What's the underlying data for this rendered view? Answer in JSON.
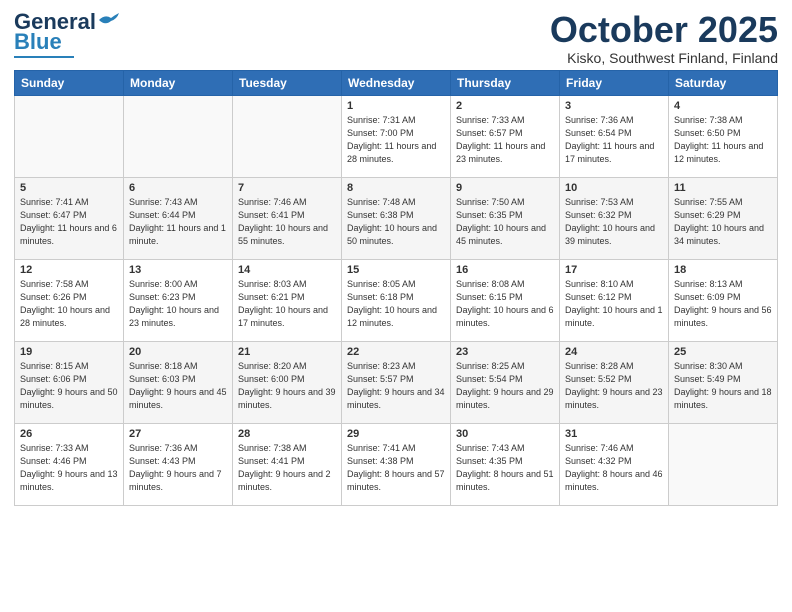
{
  "header": {
    "logo_general": "General",
    "logo_blue": "Blue",
    "month": "October 2025",
    "location": "Kisko, Southwest Finland, Finland"
  },
  "weekdays": [
    "Sunday",
    "Monday",
    "Tuesday",
    "Wednesday",
    "Thursday",
    "Friday",
    "Saturday"
  ],
  "weeks": [
    [
      {
        "day": "",
        "info": ""
      },
      {
        "day": "",
        "info": ""
      },
      {
        "day": "",
        "info": ""
      },
      {
        "day": "1",
        "info": "Sunrise: 7:31 AM\nSunset: 7:00 PM\nDaylight: 11 hours and 28 minutes."
      },
      {
        "day": "2",
        "info": "Sunrise: 7:33 AM\nSunset: 6:57 PM\nDaylight: 11 hours and 23 minutes."
      },
      {
        "day": "3",
        "info": "Sunrise: 7:36 AM\nSunset: 6:54 PM\nDaylight: 11 hours and 17 minutes."
      },
      {
        "day": "4",
        "info": "Sunrise: 7:38 AM\nSunset: 6:50 PM\nDaylight: 11 hours and 12 minutes."
      }
    ],
    [
      {
        "day": "5",
        "info": "Sunrise: 7:41 AM\nSunset: 6:47 PM\nDaylight: 11 hours and 6 minutes."
      },
      {
        "day": "6",
        "info": "Sunrise: 7:43 AM\nSunset: 6:44 PM\nDaylight: 11 hours and 1 minute."
      },
      {
        "day": "7",
        "info": "Sunrise: 7:46 AM\nSunset: 6:41 PM\nDaylight: 10 hours and 55 minutes."
      },
      {
        "day": "8",
        "info": "Sunrise: 7:48 AM\nSunset: 6:38 PM\nDaylight: 10 hours and 50 minutes."
      },
      {
        "day": "9",
        "info": "Sunrise: 7:50 AM\nSunset: 6:35 PM\nDaylight: 10 hours and 45 minutes."
      },
      {
        "day": "10",
        "info": "Sunrise: 7:53 AM\nSunset: 6:32 PM\nDaylight: 10 hours and 39 minutes."
      },
      {
        "day": "11",
        "info": "Sunrise: 7:55 AM\nSunset: 6:29 PM\nDaylight: 10 hours and 34 minutes."
      }
    ],
    [
      {
        "day": "12",
        "info": "Sunrise: 7:58 AM\nSunset: 6:26 PM\nDaylight: 10 hours and 28 minutes."
      },
      {
        "day": "13",
        "info": "Sunrise: 8:00 AM\nSunset: 6:23 PM\nDaylight: 10 hours and 23 minutes."
      },
      {
        "day": "14",
        "info": "Sunrise: 8:03 AM\nSunset: 6:21 PM\nDaylight: 10 hours and 17 minutes."
      },
      {
        "day": "15",
        "info": "Sunrise: 8:05 AM\nSunset: 6:18 PM\nDaylight: 10 hours and 12 minutes."
      },
      {
        "day": "16",
        "info": "Sunrise: 8:08 AM\nSunset: 6:15 PM\nDaylight: 10 hours and 6 minutes."
      },
      {
        "day": "17",
        "info": "Sunrise: 8:10 AM\nSunset: 6:12 PM\nDaylight: 10 hours and 1 minute."
      },
      {
        "day": "18",
        "info": "Sunrise: 8:13 AM\nSunset: 6:09 PM\nDaylight: 9 hours and 56 minutes."
      }
    ],
    [
      {
        "day": "19",
        "info": "Sunrise: 8:15 AM\nSunset: 6:06 PM\nDaylight: 9 hours and 50 minutes."
      },
      {
        "day": "20",
        "info": "Sunrise: 8:18 AM\nSunset: 6:03 PM\nDaylight: 9 hours and 45 minutes."
      },
      {
        "day": "21",
        "info": "Sunrise: 8:20 AM\nSunset: 6:00 PM\nDaylight: 9 hours and 39 minutes."
      },
      {
        "day": "22",
        "info": "Sunrise: 8:23 AM\nSunset: 5:57 PM\nDaylight: 9 hours and 34 minutes."
      },
      {
        "day": "23",
        "info": "Sunrise: 8:25 AM\nSunset: 5:54 PM\nDaylight: 9 hours and 29 minutes."
      },
      {
        "day": "24",
        "info": "Sunrise: 8:28 AM\nSunset: 5:52 PM\nDaylight: 9 hours and 23 minutes."
      },
      {
        "day": "25",
        "info": "Sunrise: 8:30 AM\nSunset: 5:49 PM\nDaylight: 9 hours and 18 minutes."
      }
    ],
    [
      {
        "day": "26",
        "info": "Sunrise: 7:33 AM\nSunset: 4:46 PM\nDaylight: 9 hours and 13 minutes."
      },
      {
        "day": "27",
        "info": "Sunrise: 7:36 AM\nSunset: 4:43 PM\nDaylight: 9 hours and 7 minutes."
      },
      {
        "day": "28",
        "info": "Sunrise: 7:38 AM\nSunset: 4:41 PM\nDaylight: 9 hours and 2 minutes."
      },
      {
        "day": "29",
        "info": "Sunrise: 7:41 AM\nSunset: 4:38 PM\nDaylight: 8 hours and 57 minutes."
      },
      {
        "day": "30",
        "info": "Sunrise: 7:43 AM\nSunset: 4:35 PM\nDaylight: 8 hours and 51 minutes."
      },
      {
        "day": "31",
        "info": "Sunrise: 7:46 AM\nSunset: 4:32 PM\nDaylight: 8 hours and 46 minutes."
      },
      {
        "day": "",
        "info": ""
      }
    ]
  ]
}
